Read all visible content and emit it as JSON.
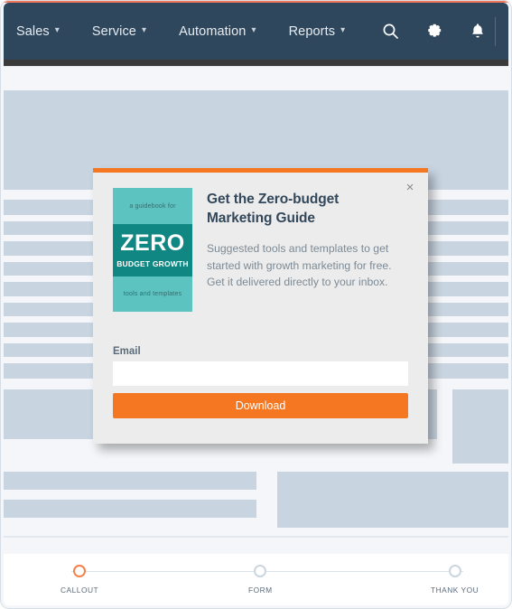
{
  "colors": {
    "nav_bg": "#2e475d",
    "accent_orange": "#f57722",
    "top_accent": "#f2775a",
    "wireframe_block": "#c8d4e0",
    "book_light_teal": "#5dc3c0",
    "book_dark_teal": "#108783",
    "step_active": "#f2814a"
  },
  "nav": {
    "items": [
      {
        "label": "Sales",
        "caret": "⌄"
      },
      {
        "label": "Service",
        "caret": "⌄"
      },
      {
        "label": "Automation",
        "caret": "⌄"
      },
      {
        "label": "Reports",
        "caret": "⌄"
      }
    ],
    "icons": [
      {
        "name": "search-icon"
      },
      {
        "name": "gear-icon"
      },
      {
        "name": "bell-icon"
      }
    ]
  },
  "modal": {
    "close_label": "×",
    "heading": "Get the Zero-budget Marketing Guide",
    "description": "Suggested tools and templates to get started with growth marketing for free. Get it delivered directly to your inbox.",
    "book": {
      "top_text": "a guidebook for",
      "title": "ZERO",
      "subtitle": "BUDGET GROWTH",
      "bottom_text": "tools and templates"
    },
    "form": {
      "email_label": "Email",
      "email_value": "",
      "email_placeholder": "",
      "submit_label": "Download"
    }
  },
  "stepper": {
    "steps": [
      {
        "label": "CALLOUT",
        "active": true
      },
      {
        "label": "FORM",
        "active": false
      },
      {
        "label": "THANK YOU",
        "active": false
      }
    ]
  }
}
